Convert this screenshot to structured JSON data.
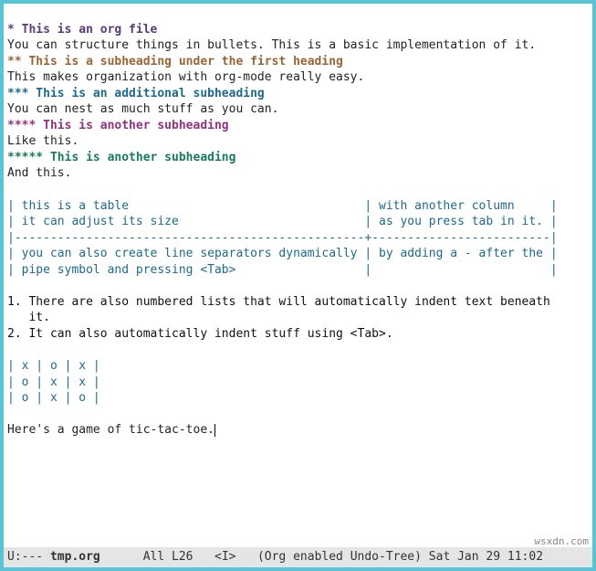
{
  "headings": {
    "h1": "* This is an org file",
    "h1_body": "You can structure things in bullets. This is a basic implementation of it.",
    "h2": "** This is a subheading under the first heading",
    "h2_body": "This makes organization with org-mode really easy.",
    "h3": "*** This is an additional subheading",
    "h3_body": "You can nest as much stuff as you can.",
    "h4": "**** This is another subheading",
    "h4_body": "Like this.",
    "h5": "***** This is another subheading",
    "h5_body": "And this."
  },
  "table1": {
    "r1": "| this is a table                                 | with another column     |",
    "r2": "| it can adjust its size                          | as you press tab in it. |",
    "sep": "|-------------------------------------------------+-------------------------|",
    "r3": "| you can also create line separators dynamically | by adding a - after the |",
    "r4": "| pipe symbol and pressing <Tab>                  |                         |"
  },
  "list": {
    "i1a": "1. There are also numbered lists that will automatically indent text beneath",
    "i1b": "   it.",
    "i2": "2. It can also automatically indent stuff using <Tab>."
  },
  "table2": {
    "r1": "| x | o | x |",
    "r2": "| o | x | x |",
    "r3": "| o | x | o |"
  },
  "tail": "Here's a game of tic-tac-toe.",
  "modeline": {
    "left": "U:--- ",
    "fname": "tmp.org",
    "rest": "      All L26   <I>   (Org enabled Undo-Tree) Sat Jan 29 11:02"
  },
  "watermark": "wsxdn.com"
}
